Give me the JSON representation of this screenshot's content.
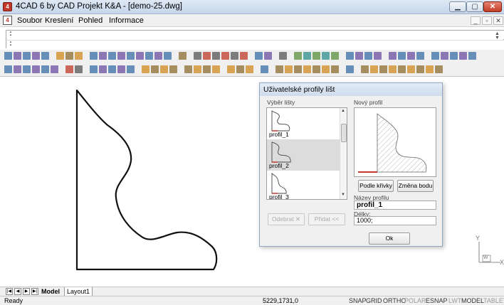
{
  "window": {
    "title": "4CAD 6 by CAD Projekt K&A - [demo-25.dwg]"
  },
  "menu": {
    "items": [
      "Soubor",
      "Kreslení",
      "Pohled",
      "Informace"
    ]
  },
  "command": {
    "line1": ":",
    "line2": ":"
  },
  "dialog": {
    "title": "Uživatelské profily lišt",
    "list_label": "Výběr lišty",
    "preview_label": "Nový profil",
    "profiles": [
      "profil_1",
      "profil_2",
      "profil_3"
    ],
    "buttons": {
      "remove": "Odebrat ✕",
      "add": "Přidat <<",
      "by_curve": "Podle křivky",
      "change_point": "Změna bodu",
      "ok": "Ok"
    },
    "name_label": "Název profilu",
    "name_value": "profil_1",
    "length_label": "Délky:",
    "length_value": "1000;"
  },
  "tabs": {
    "model": "Model",
    "layout": "Layout1"
  },
  "status": {
    "ready": "Ready",
    "coords": "5229,1731,0",
    "toggles": [
      "SNAP",
      "GRID",
      "ORTHO",
      "POLAR",
      "ESNAP",
      "LWT",
      "MODEL",
      "TABLET"
    ]
  },
  "ucs": {
    "y": "Y",
    "w": "W",
    "x": "X"
  },
  "icons": [
    "app-logo-icon",
    "minimize-icon",
    "maximize-icon",
    "close-icon",
    "document-icon"
  ],
  "colors": {
    "accent_red": "#c0392b",
    "title_blue": "#c5d6ea"
  }
}
